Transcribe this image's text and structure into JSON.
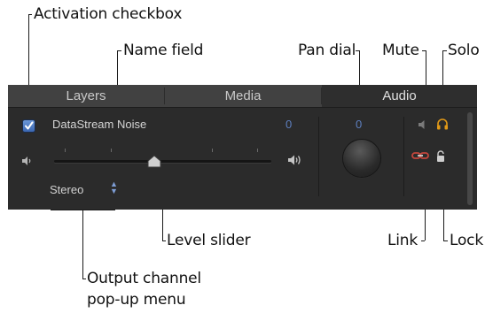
{
  "callouts": {
    "activation_checkbox": "Activation checkbox",
    "name_field": "Name field",
    "pan_dial": "Pan dial",
    "mute": "Mute",
    "solo": "Solo",
    "level_slider": "Level slider",
    "link": "Link",
    "lock": "Lock",
    "output_channel_line1": "Output channel",
    "output_channel_line2": "pop-up menu"
  },
  "tabs": [
    {
      "label": "Layers",
      "selected": false
    },
    {
      "label": "Media",
      "selected": false
    },
    {
      "label": "Audio",
      "selected": true
    }
  ],
  "track": {
    "enabled": true,
    "name": "DataStream Noise",
    "level_value": "0",
    "pan_value": "0",
    "output_channel": "Stereo",
    "level_fraction": 0.46
  },
  "icons": {
    "volume_low": "speaker-low-icon",
    "volume_high": "speaker-high-icon",
    "mute": "speaker-mute-icon",
    "solo": "headphones-icon",
    "link": "link-icon",
    "lock": "lock-icon"
  },
  "colors": {
    "panel_bg": "#2b2b2b",
    "tab_bg": "#414141",
    "accent_blue": "#5d7fbf",
    "solo_orange": "#e39a17",
    "link_red": "#c4463c"
  }
}
